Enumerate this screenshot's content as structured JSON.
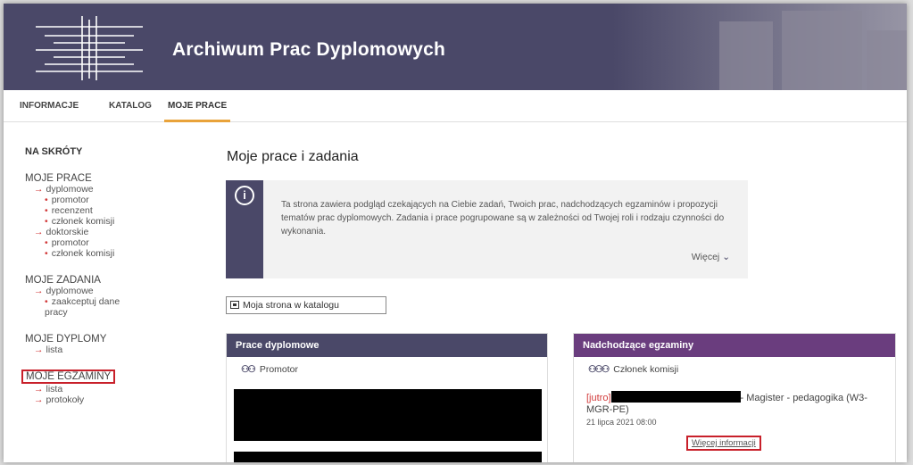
{
  "header": {
    "title": "Archiwum Prac Dyplomowych"
  },
  "nav": {
    "items": [
      "INFORMACJE",
      "KATALOG",
      "MOJE PRACE"
    ],
    "active": "MOJE PRACE"
  },
  "sidebar": {
    "heading": "NA SKRÓTY",
    "sections": [
      {
        "title": "MOJE PRACE",
        "subs": [
          {
            "label": "dyplomowe",
            "items": [
              "promotor",
              "recenzent",
              "członek komisji"
            ]
          },
          {
            "label": "doktorskie",
            "items": [
              "promotor",
              "członek komisji"
            ]
          }
        ]
      },
      {
        "title": "MOJE ZADANIA",
        "subs": [
          {
            "label": "dyplomowe",
            "items": [
              "zaakceptuj dane pracy"
            ]
          }
        ]
      },
      {
        "title": "MOJE DYPLOMY",
        "subs": [
          {
            "label": "lista",
            "items": []
          }
        ]
      },
      {
        "title": "MOJE EGZAMINY",
        "subs": [
          {
            "label": "lista",
            "items": []
          },
          {
            "label": "protokoły",
            "items": []
          }
        ]
      }
    ]
  },
  "main": {
    "title": "Moje prace i zadania",
    "info_text": "Ta strona zawiera podgląd czekających na Ciebie zadań, Twoich prac, nadchodzących egzaminów i propozycji tematów prac dyplomowych. Zadania i prace pogrupowane są w zależności od Twojej roli i rodzaju czynności do wykonania.",
    "info_more": "Więcej",
    "catalog_button": "Moja strona w katalogu",
    "panel_theses": {
      "title": "Prace dyplomowe",
      "role": "Promotor"
    },
    "panel_exams": {
      "title": "Nadchodzące egzaminy",
      "role": "Członek komisji",
      "exam_tag": "[jutro]",
      "exam_desc": "- Magister - pedagogika (W3-MGR-PE)",
      "exam_date": "21 lipca 2021 08:00",
      "more_info": "Więcej informacji"
    }
  },
  "colors": {
    "header": "#4a4868",
    "exams_header": "#6a3d7e",
    "highlight": "#c8202a",
    "accent": "#e9a33a"
  }
}
